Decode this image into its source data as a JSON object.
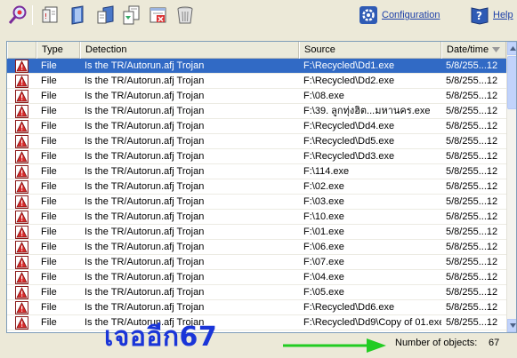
{
  "toolbar": {
    "configuration_label": "Configuration",
    "help_label": "Help"
  },
  "columns": [
    "",
    "Type",
    "Detection",
    "Source",
    "Date/time"
  ],
  "rows": [
    {
      "type": "File",
      "detection": "Is the TR/Autorun.afj Trojan",
      "source": "F:\\Recycled\\Dd1.exe",
      "date": "5/8/255...12",
      "selected": true
    },
    {
      "type": "File",
      "detection": "Is the TR/Autorun.afj Trojan",
      "source": "F:\\Recycled\\Dd2.exe",
      "date": "5/8/255...12"
    },
    {
      "type": "File",
      "detection": "Is the TR/Autorun.afj Trojan",
      "source": "F:\\08.exe",
      "date": "5/8/255...12"
    },
    {
      "type": "File",
      "detection": "Is the TR/Autorun.afj Trojan",
      "source": "F:\\39. ลูกทุ่งฮิต...มหานคร.exe",
      "date": "5/8/255...12"
    },
    {
      "type": "File",
      "detection": "Is the TR/Autorun.afj Trojan",
      "source": "F:\\Recycled\\Dd4.exe",
      "date": "5/8/255...12"
    },
    {
      "type": "File",
      "detection": "Is the TR/Autorun.afj Trojan",
      "source": "F:\\Recycled\\Dd5.exe",
      "date": "5/8/255...12"
    },
    {
      "type": "File",
      "detection": "Is the TR/Autorun.afj Trojan",
      "source": "F:\\Recycled\\Dd3.exe",
      "date": "5/8/255...12"
    },
    {
      "type": "File",
      "detection": "Is the TR/Autorun.afj Trojan",
      "source": "F:\\114.exe",
      "date": "5/8/255...12"
    },
    {
      "type": "File",
      "detection": "Is the TR/Autorun.afj Trojan",
      "source": "F:\\02.exe",
      "date": "5/8/255...12"
    },
    {
      "type": "File",
      "detection": "Is the TR/Autorun.afj Trojan",
      "source": "F:\\03.exe",
      "date": "5/8/255...12"
    },
    {
      "type": "File",
      "detection": "Is the TR/Autorun.afj Trojan",
      "source": "F:\\10.exe",
      "date": "5/8/255...12"
    },
    {
      "type": "File",
      "detection": "Is the TR/Autorun.afj Trojan",
      "source": "F:\\01.exe",
      "date": "5/8/255...12"
    },
    {
      "type": "File",
      "detection": "Is the TR/Autorun.afj Trojan",
      "source": "F:\\06.exe",
      "date": "5/8/255...12"
    },
    {
      "type": "File",
      "detection": "Is the TR/Autorun.afj Trojan",
      "source": "F:\\07.exe",
      "date": "5/8/255...12"
    },
    {
      "type": "File",
      "detection": "Is the TR/Autorun.afj Trojan",
      "source": "F:\\04.exe",
      "date": "5/8/255...12"
    },
    {
      "type": "File",
      "detection": "Is the TR/Autorun.afj Trojan",
      "source": "F:\\05.exe",
      "date": "5/8/255...12"
    },
    {
      "type": "File",
      "detection": "Is the TR/Autorun.afj Trojan",
      "source": "F:\\Recycled\\Dd6.exe",
      "date": "5/8/255...12"
    },
    {
      "type": "File",
      "detection": "Is the TR/Autorun.afj Trojan",
      "source": "F:\\Recycled\\Dd9\\Copy of 01.exe",
      "date": "5/8/255...12"
    }
  ],
  "annotation": {
    "text": "เจออีก67",
    "color": "#1a35d8",
    "arrow_color": "#22cc22"
  },
  "status": {
    "count_label": "Number of objects:",
    "count_value": "67"
  },
  "colors": {
    "selection": "#316ac5",
    "link": "#1c3fa8",
    "warning_icon": "#cc2222"
  }
}
